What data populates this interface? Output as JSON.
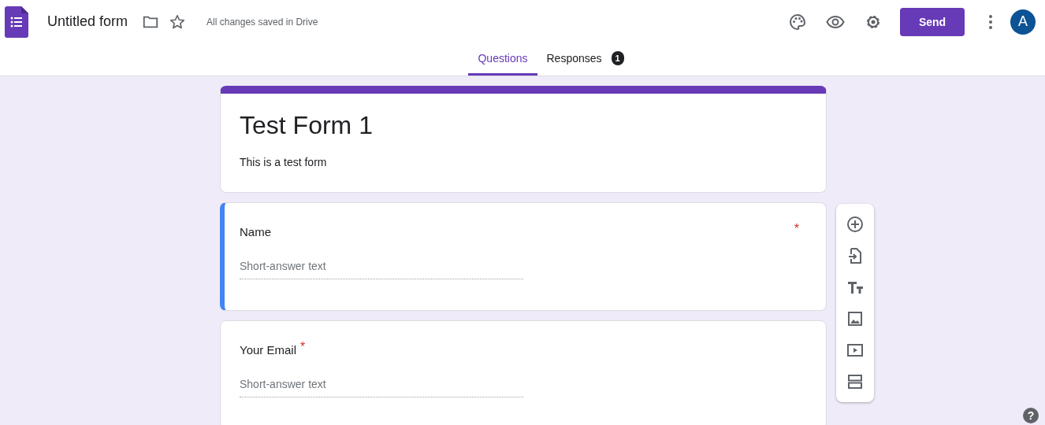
{
  "header": {
    "title": "Untitled form",
    "save_status": "All changes saved in Drive",
    "send_label": "Send",
    "avatar_initial": "A"
  },
  "tabs": [
    {
      "label": "Questions",
      "selected": true
    },
    {
      "label": "Responses",
      "selected": false,
      "badge": "1"
    }
  ],
  "form": {
    "title": "Test Form 1",
    "description": "This is a test form"
  },
  "questions": [
    {
      "title": "Name",
      "required_mark": "*",
      "placeholder": "Short-answer text",
      "selected": true
    },
    {
      "title": "Your Email",
      "required_mark": "*",
      "placeholder": "Short-answer text",
      "selected": false
    }
  ],
  "help_label": "?"
}
